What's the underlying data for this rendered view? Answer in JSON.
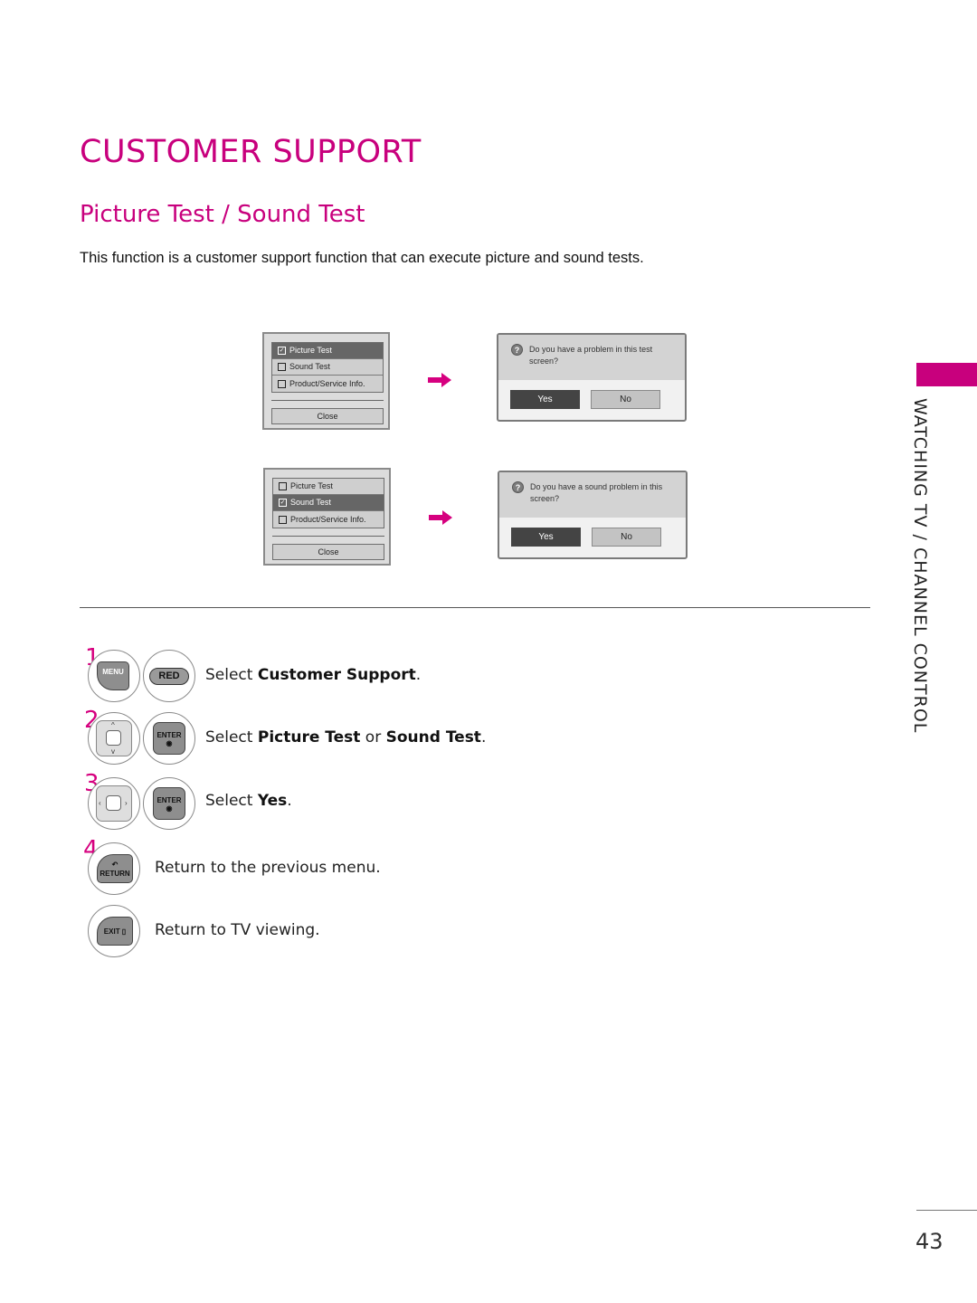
{
  "page": {
    "title": "CUSTOMER SUPPORT",
    "subtitle": "Picture Test / Sound Test",
    "intro": "This function is a customer support function that can execute picture and sound tests.",
    "side_tab": "WATCHING TV / CHANNEL CONTROL",
    "page_number": "43",
    "accent_color": "#c8007d"
  },
  "figures": [
    {
      "menu": {
        "items": [
          {
            "label": "Picture Test",
            "checked": true,
            "selected": true
          },
          {
            "label": "Sound Test",
            "checked": false,
            "selected": false
          },
          {
            "label": "Product/Service Info.",
            "checked": false,
            "selected": false
          }
        ],
        "close_label": "Close"
      },
      "dialog": {
        "icon": "question-icon",
        "message": "Do you have a problem in this test screen?",
        "yes_label": "Yes",
        "no_label": "No"
      }
    },
    {
      "menu": {
        "items": [
          {
            "label": "Picture Test",
            "checked": false,
            "selected": false
          },
          {
            "label": "Sound Test",
            "checked": true,
            "selected": true
          },
          {
            "label": "Product/Service Info.",
            "checked": false,
            "selected": false
          }
        ],
        "close_label": "Close"
      },
      "dialog": {
        "icon": "question-icon",
        "message": "Do you have a sound problem in this screen?",
        "yes_label": "Yes",
        "no_label": "No"
      }
    }
  ],
  "steps": [
    {
      "number": "1",
      "keys": [
        "MENU",
        "RED"
      ],
      "prefix": "Select ",
      "bold1": "Customer Support",
      "mid": "",
      "bold2": "",
      "suffix": "."
    },
    {
      "number": "2",
      "keys": [
        "up-down-nav",
        "ENTER"
      ],
      "prefix": "Select ",
      "bold1": "Picture Test",
      "mid": " or ",
      "bold2": "Sound Test",
      "suffix": "."
    },
    {
      "number": "3",
      "keys": [
        "left-right-nav",
        "ENTER"
      ],
      "prefix": "Select ",
      "bold1": "Yes",
      "mid": "",
      "bold2": "",
      "suffix": "."
    },
    {
      "number": "4",
      "keys": [
        "RETURN"
      ],
      "text": "Return to the previous menu."
    },
    {
      "number": "",
      "keys": [
        "EXIT"
      ],
      "text": "Return to TV viewing."
    }
  ],
  "keys": {
    "menu": "MENU",
    "red": "RED",
    "enter": "ENTER",
    "return": "RETURN",
    "exit": "EXIT"
  }
}
